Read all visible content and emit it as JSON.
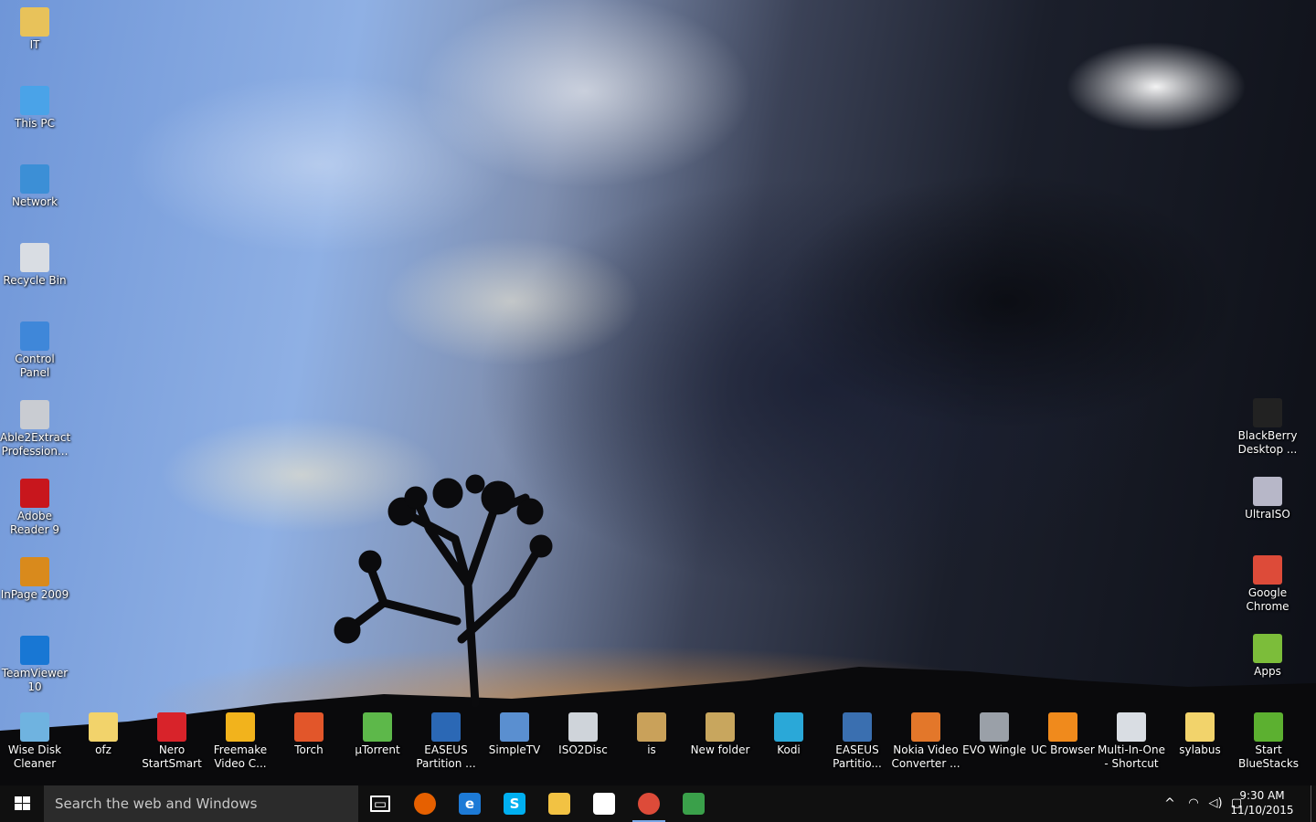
{
  "desktop": {
    "left_icons": [
      {
        "label": "IT",
        "icon": "user-folder-icon",
        "color": "#e8c25a"
      },
      {
        "label": "This PC",
        "icon": "computer-icon",
        "color": "#4aa3e8"
      },
      {
        "label": "Network",
        "icon": "network-globe-icon",
        "color": "#3c8fd6"
      },
      {
        "label": "Recycle Bin",
        "icon": "recycle-bin-icon",
        "color": "#d9dde3"
      },
      {
        "label": "Control Panel",
        "icon": "control-panel-icon",
        "color": "#3f87d9"
      },
      {
        "label": "Able2Extract Profession...",
        "icon": "able2extract-icon",
        "color": "#c9ccd2"
      },
      {
        "label": "Adobe Reader 9",
        "icon": "adobe-reader-icon",
        "color": "#c8161d"
      },
      {
        "label": "InPage 2009",
        "icon": "inpage-icon",
        "color": "#d98a1c"
      },
      {
        "label": "TeamViewer 10",
        "icon": "teamviewer-icon",
        "color": "#1877d4"
      }
    ],
    "right_icons": [
      {
        "label": "BlackBerry Desktop ...",
        "icon": "blackberry-icon",
        "color": "#222222"
      },
      {
        "label": "UltraISO",
        "icon": "ultraiso-disc-icon",
        "color": "#b7b7c8"
      },
      {
        "label": "Google Chrome",
        "icon": "chrome-icon",
        "color": "#dd4b39"
      },
      {
        "label": "Apps",
        "icon": "apps-android-icon",
        "color": "#7cbd3a"
      }
    ],
    "bottom_icons": [
      {
        "label": "Wise Disk Cleaner",
        "icon": "wise-disk-cleaner-icon",
        "color": "#6fb3e0"
      },
      {
        "label": "ofz",
        "icon": "folder-icon",
        "color": "#f2d36b"
      },
      {
        "label": "Nero StartSmart",
        "icon": "nero-icon",
        "color": "#d8232a"
      },
      {
        "label": "Freemake Video C...",
        "icon": "freemake-icon",
        "color": "#f2b31c"
      },
      {
        "label": "Torch",
        "icon": "torch-icon",
        "color": "#e2562a"
      },
      {
        "label": "µTorrent",
        "icon": "utorrent-icon",
        "color": "#5db84a"
      },
      {
        "label": "EASEUS Partition ...",
        "icon": "easeus-icon",
        "color": "#2b68b5"
      },
      {
        "label": "SimpleTV",
        "icon": "simpletv-icon",
        "color": "#5a8fd0"
      },
      {
        "label": "ISO2Disc",
        "icon": "iso2disc-icon",
        "color": "#cfd4da"
      },
      {
        "label": "is",
        "icon": "folder-icon",
        "color": "#c9a15a"
      },
      {
        "label": "New folder",
        "icon": "folder-icon",
        "color": "#c8a65e"
      },
      {
        "label": "Kodi",
        "icon": "kodi-icon",
        "color": "#2aa8d8"
      },
      {
        "label": "EASEUS Partitio...",
        "icon": "easeus-icon",
        "color": "#3a6fb0"
      },
      {
        "label": "Nokia Video Converter ...",
        "icon": "nokia-video-converter-icon",
        "color": "#e3772a"
      },
      {
        "label": "EVO Wingle",
        "icon": "evo-wingle-icon",
        "color": "#9aa0a8"
      },
      {
        "label": "UC Browser",
        "icon": "uc-browser-icon",
        "color": "#f08a1c"
      },
      {
        "label": "Multi-In-One - Shortcut",
        "icon": "multi-in-one-icon",
        "color": "#d9dde3"
      },
      {
        "label": "sylabus",
        "icon": "folder-icon",
        "color": "#f2d36b"
      },
      {
        "label": "Start BlueStacks",
        "icon": "bluestacks-icon",
        "color": "#5cb030"
      }
    ]
  },
  "taskbar": {
    "search_placeholder": "Search the web and Windows",
    "apps": [
      {
        "name": "task-view",
        "icon": "task-view-icon",
        "glyph": "▭",
        "color": "#101010"
      },
      {
        "name": "firefox",
        "icon": "firefox-icon",
        "glyph": "",
        "color": "#e66000"
      },
      {
        "name": "edge",
        "icon": "edge-icon",
        "glyph": "e",
        "color": "#1d7ad6"
      },
      {
        "name": "skype",
        "icon": "skype-icon",
        "glyph": "S",
        "color": "#00aff0"
      },
      {
        "name": "file-explorer",
        "icon": "file-explorer-icon",
        "glyph": "",
        "color": "#f2c243"
      },
      {
        "name": "store",
        "icon": "store-icon",
        "glyph": "",
        "color": "#ffffff"
      },
      {
        "name": "chrome",
        "icon": "chrome-icon",
        "glyph": "",
        "color": "#dd4b39"
      },
      {
        "name": "remote-desktop",
        "icon": "remote-desktop-icon",
        "glyph": "",
        "color": "#3aa04a"
      }
    ],
    "tray": {
      "chevron": "^",
      "time": "9:30 AM",
      "date": "11/10/2015"
    }
  }
}
